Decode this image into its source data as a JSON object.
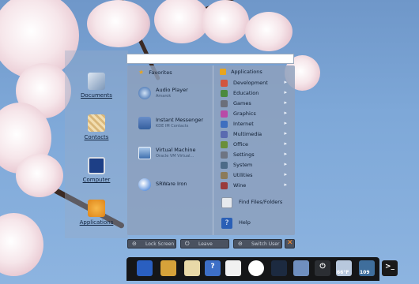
{
  "colors": {
    "panel": "#8ea0bc",
    "accent": "#e8a51f",
    "taskbar": "#151618"
  },
  "search": {
    "value": "",
    "placeholder": ""
  },
  "left_launchers": [
    {
      "label": "Documents",
      "icon": "documents-chart-icon"
    },
    {
      "label": "Contacts",
      "icon": "contacts-stamp-icon"
    },
    {
      "label": "Computer",
      "icon": "monitor-icon"
    },
    {
      "label": "Applications",
      "icon": "applications-grid-icon"
    }
  ],
  "favorites": {
    "header": "Favorites",
    "items": [
      {
        "title": "Audio Player",
        "subtitle": "Amarok",
        "icon": "audio-player-icon"
      },
      {
        "title": "Instant Messenger",
        "subtitle": "KDE IM Contacts",
        "icon": "messenger-icon"
      },
      {
        "title": "Virtual Machine",
        "subtitle": "Oracle VM Virtual...",
        "icon": "virtual-machine-icon"
      },
      {
        "title": "SRWare Iron",
        "subtitle": "",
        "icon": "srware-iron-icon"
      }
    ]
  },
  "applications": {
    "header": "Applications",
    "items": [
      {
        "label": "Development",
        "icon": "development-icon",
        "color": "#d2553f"
      },
      {
        "label": "Education",
        "icon": "education-icon",
        "color": "#4b8a3e"
      },
      {
        "label": "Games",
        "icon": "games-icon",
        "color": "#6b6f7a"
      },
      {
        "label": "Graphics",
        "icon": "graphics-icon",
        "color": "#b94aa7"
      },
      {
        "label": "Internet",
        "icon": "internet-icon",
        "color": "#3e6fbf"
      },
      {
        "label": "Multimedia",
        "icon": "multimedia-icon",
        "color": "#5a6bb0"
      },
      {
        "label": "Office",
        "icon": "office-icon",
        "color": "#6a8f3b"
      },
      {
        "label": "Settings",
        "icon": "settings-icon",
        "color": "#6e7583"
      },
      {
        "label": "System",
        "icon": "system-icon",
        "color": "#4d6b88"
      },
      {
        "label": "Utilities",
        "icon": "utilities-icon",
        "color": "#8c7b5a"
      },
      {
        "label": "Wine",
        "icon": "wine-icon",
        "color": "#9a3b3b"
      }
    ],
    "arrow": "▸"
  },
  "tools": [
    {
      "label": "Find Files/Folders",
      "icon": "find-files-icon"
    },
    {
      "label": "Help",
      "icon": "help-icon",
      "glyph": "?"
    }
  ],
  "bottom_buttons": [
    {
      "label": "Lock Screen",
      "icon": "lock-icon",
      "glyph": "⊝"
    },
    {
      "label": "Leave",
      "icon": "power-icon",
      "glyph": "⏻"
    },
    {
      "label": "Switch User",
      "icon": "switch-user-icon",
      "glyph": "⊝"
    }
  ],
  "taskbar": {
    "items": [
      {
        "icon": "kde-menu-icon"
      },
      {
        "icon": "paint-palette-icon"
      },
      {
        "icon": "document-writer-icon"
      },
      {
        "icon": "help-center-icon",
        "glyph": "?"
      },
      {
        "icon": "mail-icon"
      },
      {
        "icon": "browser-sphere-icon"
      },
      {
        "icon": "dashboard-icon"
      },
      {
        "icon": "screen-capture-icon"
      },
      {
        "icon": "shutdown-icon",
        "glyph": "⏻"
      },
      {
        "icon": "weather-icon",
        "badge": "66°F"
      },
      {
        "icon": "battery-icon",
        "badge": "109"
      },
      {
        "icon": "terminal-icon",
        "glyph": ">_"
      }
    ]
  }
}
